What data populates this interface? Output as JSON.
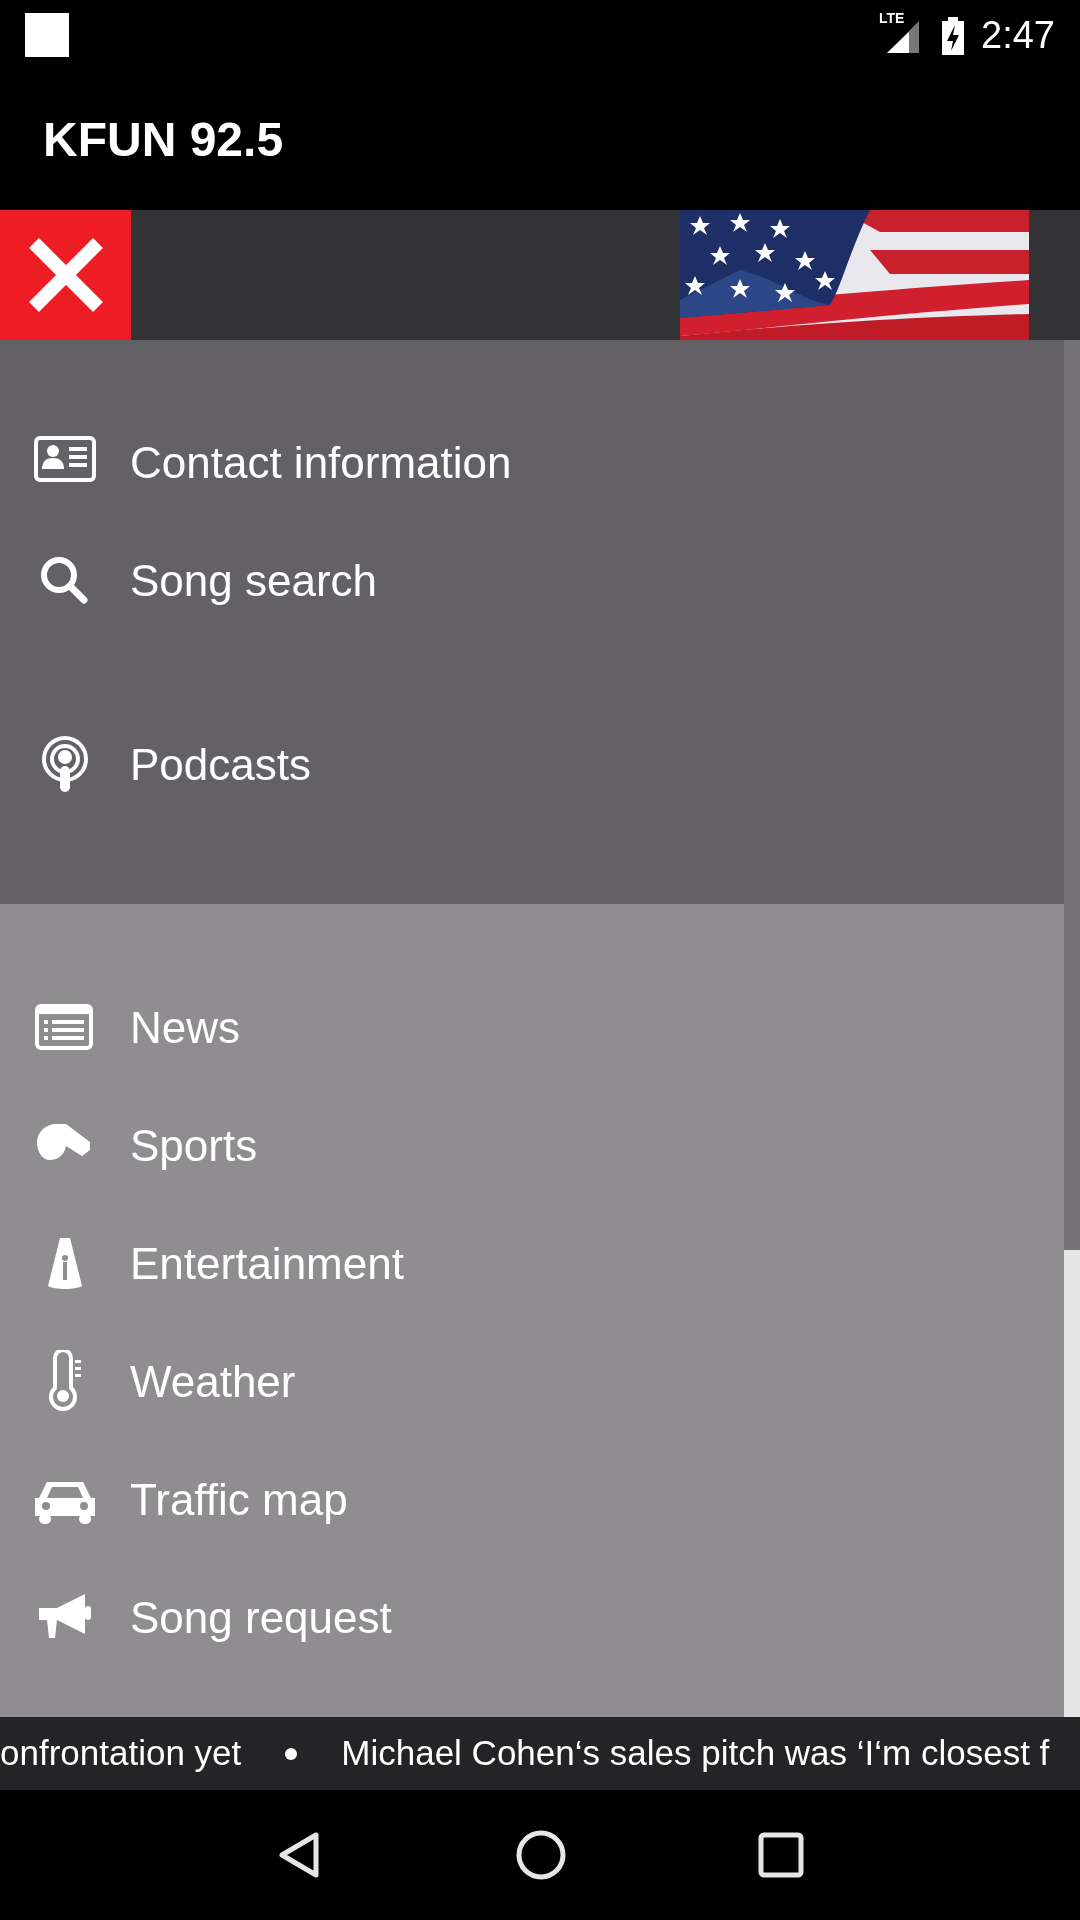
{
  "status_bar": {
    "time": "2:47",
    "network": "LTE"
  },
  "app_bar": {
    "title": "KFUN 92.5"
  },
  "header": {
    "close": true
  },
  "menu_sections": [
    {
      "items": [
        {
          "label": "Contact information"
        },
        {
          "label": "Song search"
        },
        {
          "label": "Podcasts"
        }
      ]
    },
    {
      "items": [
        {
          "label": "News"
        },
        {
          "label": "Sports"
        },
        {
          "label": "Entertainment"
        },
        {
          "label": "Weather"
        },
        {
          "label": "Traffic map"
        },
        {
          "label": "Song request"
        }
      ]
    }
  ],
  "ticker": [
    "onfrontation yet",
    "Michael Cohen‘s sales pitch was ‘I‘m closest f"
  ]
}
